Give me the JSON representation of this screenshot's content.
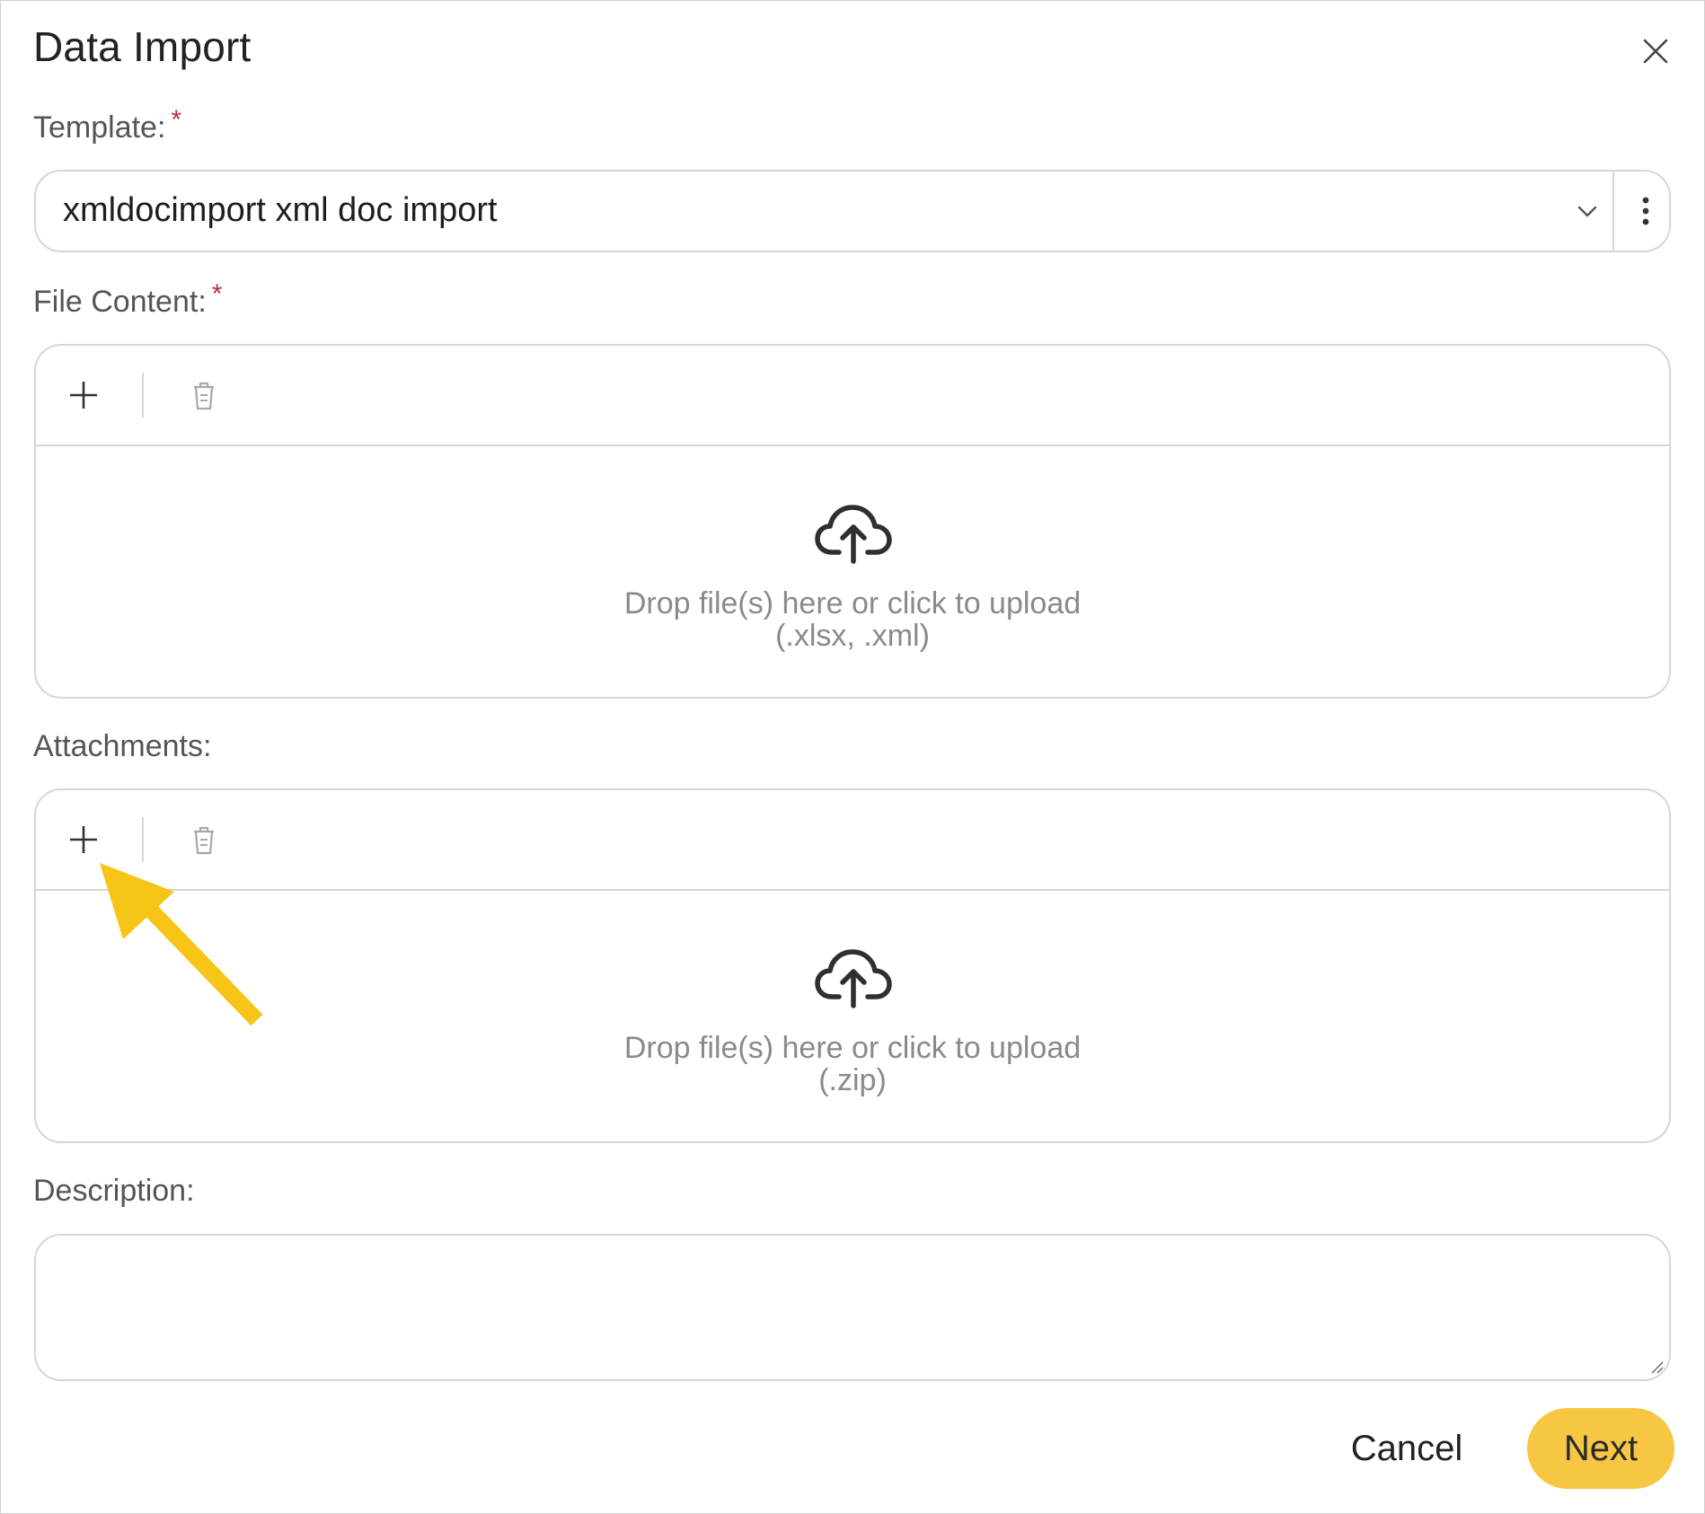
{
  "dialog": {
    "title": "Data Import"
  },
  "template": {
    "label": "Template:",
    "required_mark": "*",
    "value": "xmldocimport xml doc import"
  },
  "file_content": {
    "label": "File Content:",
    "required_mark": "*",
    "drop_text": "Drop file(s) here or click to upload",
    "accepted_types": "(.xlsx, .xml)"
  },
  "attachments": {
    "label": "Attachments:",
    "drop_text": "Drop file(s) here or click to upload",
    "accepted_types": "(.zip)"
  },
  "description": {
    "label": "Description:",
    "value": ""
  },
  "footer": {
    "cancel_label": "Cancel",
    "next_label": "Next"
  },
  "icons": {
    "close": "close-icon",
    "chevron": "chevron-down-icon",
    "more": "more-vertical-icon",
    "add": "plus-icon",
    "delete": "trash-icon",
    "upload": "cloud-upload-icon",
    "annotation": "arrow-annotation"
  },
  "colors": {
    "accent": "#f7c744",
    "required": "#b8323a",
    "annotation": "#f6c518"
  }
}
